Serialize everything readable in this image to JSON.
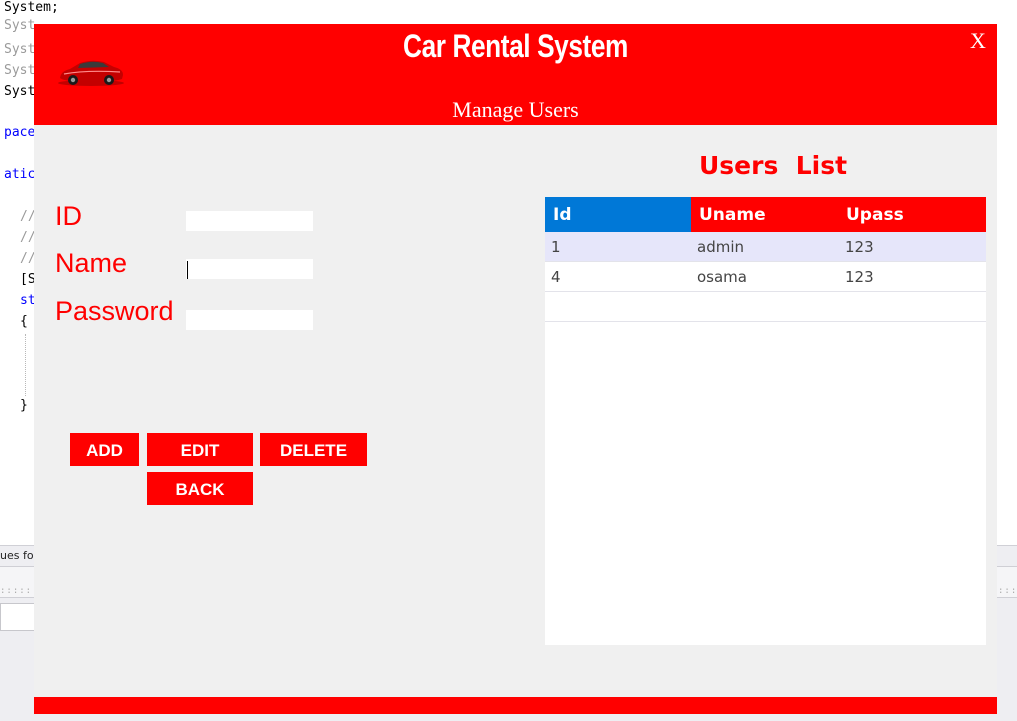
{
  "editor": {
    "code_lines": [
      {
        "text": "System;",
        "tone": "black"
      },
      {
        "text": "Syst",
        "tone": "grey"
      },
      {
        "text": "Syst",
        "tone": "grey"
      },
      {
        "text": "Syst",
        "tone": "grey"
      },
      {
        "text": "Syst",
        "tone": "black"
      },
      {
        "text": "pace",
        "tone": "blue"
      },
      {
        "text": "atic",
        "tone": "blue"
      },
      {
        "text": "//",
        "tone": "grey"
      },
      {
        "text": "//",
        "tone": "grey"
      },
      {
        "text": "//",
        "tone": "grey"
      },
      {
        "text": "[S",
        "tone": "black"
      },
      {
        "text": "st",
        "tone": "blue"
      },
      {
        "text": "{",
        "tone": "black"
      },
      {
        "text": "}",
        "tone": "black"
      }
    ],
    "output_label": "ues fo"
  },
  "app": {
    "title": "Car Rental System",
    "subtitle": "Manage Users",
    "close_label": "X",
    "colors": {
      "brand": "#ff0000",
      "id_header": "#0078d7",
      "selected_row": "#e6e6fa",
      "panel": "#f0f0f0"
    },
    "form": {
      "id_label": "ID",
      "name_label": "Name",
      "password_label": "Password",
      "id_value": "",
      "name_value": "",
      "password_value": ""
    },
    "buttons": {
      "add": "ADD",
      "edit": "EDIT",
      "delete": "DELETE",
      "back": "BACK"
    },
    "users_list": {
      "title": "Users  List",
      "columns": [
        "Id",
        "Uname",
        "Upass"
      ],
      "rows": [
        [
          "1",
          "admin",
          "123"
        ],
        [
          "4",
          "osama",
          "123"
        ]
      ]
    }
  }
}
